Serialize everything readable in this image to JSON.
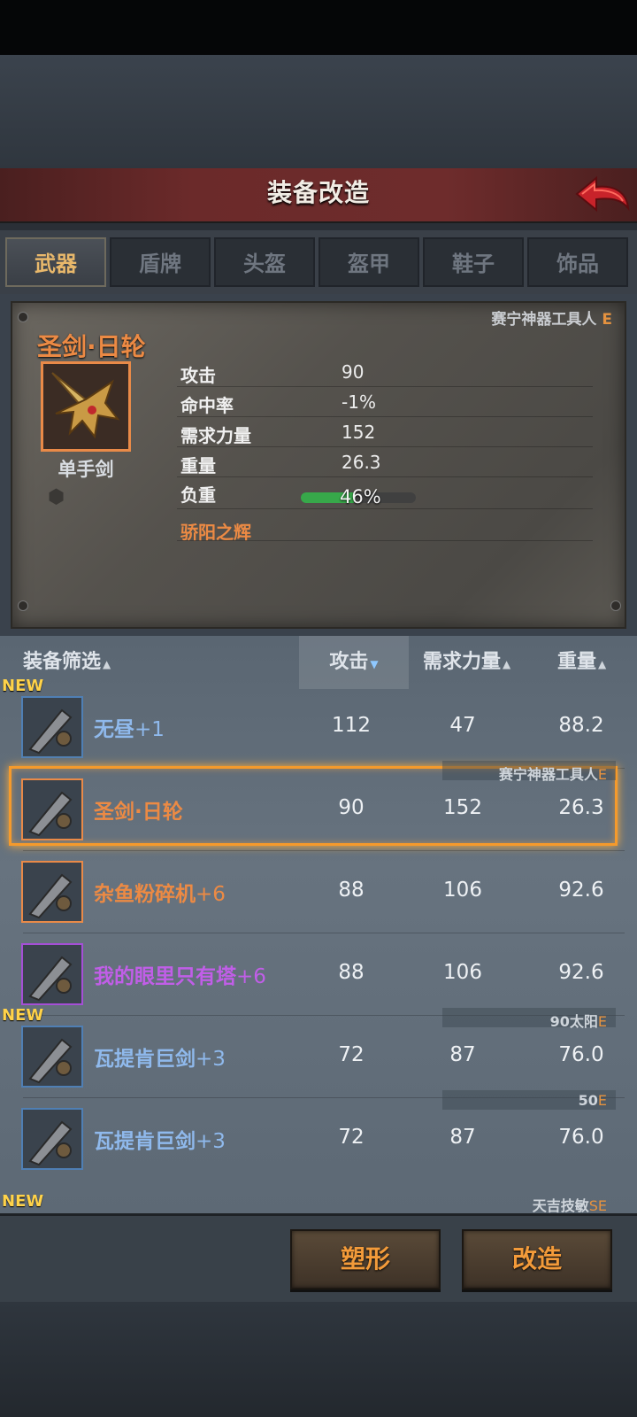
{
  "header": {
    "title": "装备改造"
  },
  "tabs": [
    {
      "label": "武器",
      "active": true
    },
    {
      "label": "盾牌",
      "active": false
    },
    {
      "label": "头盔",
      "active": false
    },
    {
      "label": "盔甲",
      "active": false
    },
    {
      "label": "鞋子",
      "active": false
    },
    {
      "label": "饰品",
      "active": false
    }
  ],
  "detail": {
    "maker": "赛宁神器工具人",
    "grade": "E",
    "name": "圣剑·日轮",
    "type": "单手剑",
    "stats": [
      {
        "label": "攻击",
        "value": "90"
      },
      {
        "label": "命中率",
        "value": "-1%"
      },
      {
        "label": "需求力量",
        "value": "152"
      },
      {
        "label": "重量",
        "value": "26.3"
      }
    ],
    "load_label": "负重",
    "load_value": "46%",
    "load_fraction": 0.46,
    "skill": "骄阳之辉"
  },
  "list_header": {
    "filter": "装备筛选",
    "attack": "攻击",
    "strength": "需求力量",
    "weight": "重量"
  },
  "items": [
    {
      "new": "NEW",
      "name": "无昼",
      "level": "+1",
      "attack": "112",
      "strength": "47",
      "weight": "88.2",
      "color": "#8fb9ec",
      "tag": "",
      "tag_grade": ""
    },
    {
      "new": "",
      "name": "圣剑·日轮",
      "level": "",
      "attack": "90",
      "strength": "152",
      "weight": "26.3",
      "color": "#ec8a44",
      "tag": "赛宁神器工具人",
      "tag_grade": "E"
    },
    {
      "new": "",
      "name": "杂鱼粉碎机",
      "level": "+6",
      "attack": "88",
      "strength": "106",
      "weight": "92.6",
      "color": "#ec8a44",
      "tag": "",
      "tag_grade": ""
    },
    {
      "new": "",
      "name": "我的眼里只有塔",
      "level": "+6",
      "attack": "88",
      "strength": "106",
      "weight": "92.6",
      "color": "#c15ee8",
      "tag": "",
      "tag_grade": ""
    },
    {
      "new": "NEW",
      "name": "瓦提肯巨剑",
      "level": "+3",
      "attack": "72",
      "strength": "87",
      "weight": "76.0",
      "color": "#8fb9ec",
      "tag": "90太阳",
      "tag_grade": "E"
    },
    {
      "new": "",
      "name": "瓦提肯巨剑",
      "level": "+3",
      "attack": "72",
      "strength": "87",
      "weight": "76.0",
      "color": "#8fb9ec",
      "tag": "50",
      "tag_grade": "E"
    }
  ],
  "partial_row": {
    "new": "NEW",
    "tag": "天吉技敏",
    "tag_grade": "SE"
  },
  "buttons": {
    "reshape": "塑形",
    "modify": "改造"
  }
}
